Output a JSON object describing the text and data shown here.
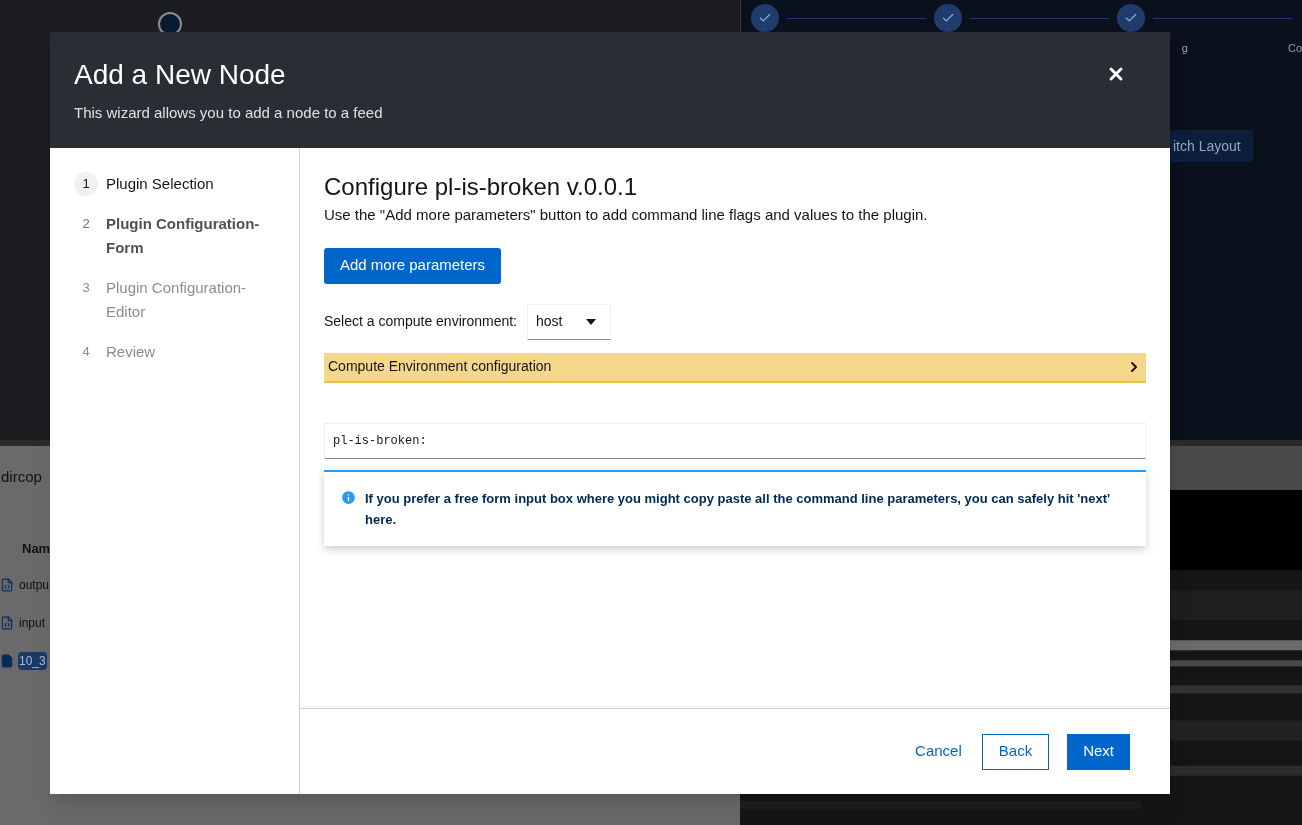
{
  "background": {
    "top_steps": [
      {
        "label": "g",
        "checked": true
      },
      {
        "label": "Co",
        "checked": true
      }
    ],
    "switch_layout": "itch Layout",
    "file_browser": {
      "title": "dircop",
      "column": "Nam",
      "files": [
        {
          "name": "outpu",
          "kind": "code",
          "selected": false
        },
        {
          "name": "input",
          "kind": "code",
          "selected": false
        },
        {
          "name": "10_3",
          "kind": "file",
          "selected": true
        }
      ]
    }
  },
  "modal": {
    "title": "Add a New Node",
    "subtitle": "This wizard allows you to add a node to a feed",
    "steps": [
      {
        "number": "1",
        "label": "Plugin Selection",
        "visited": true,
        "selected": false,
        "disabled": false
      },
      {
        "number": "2",
        "label": "Plugin Configuration-Form",
        "visited": false,
        "selected": true,
        "disabled": false
      },
      {
        "number": "3",
        "label": "Plugin Configuration-Editor",
        "visited": false,
        "selected": false,
        "disabled": true
      },
      {
        "number": "4",
        "label": "Review",
        "visited": false,
        "selected": false,
        "disabled": true
      }
    ],
    "heading": "Configure pl-is-broken v.0.0.1",
    "description": "Use the \"Add more parameters\" button to add command line flags and values to the plugin.",
    "add_button": "Add more parameters",
    "compute": {
      "label": "Select a compute environment:",
      "value": "host"
    },
    "accordion": {
      "title": "Compute Environment configuration",
      "expanded": false
    },
    "editor": {
      "value": "pl-is-broken:"
    },
    "info": "If you prefer a free form input box where you might copy paste all the command line parameters, you can safely hit 'next' here.",
    "footer": {
      "cancel": "Cancel",
      "back": "Back",
      "next": "Next"
    }
  }
}
